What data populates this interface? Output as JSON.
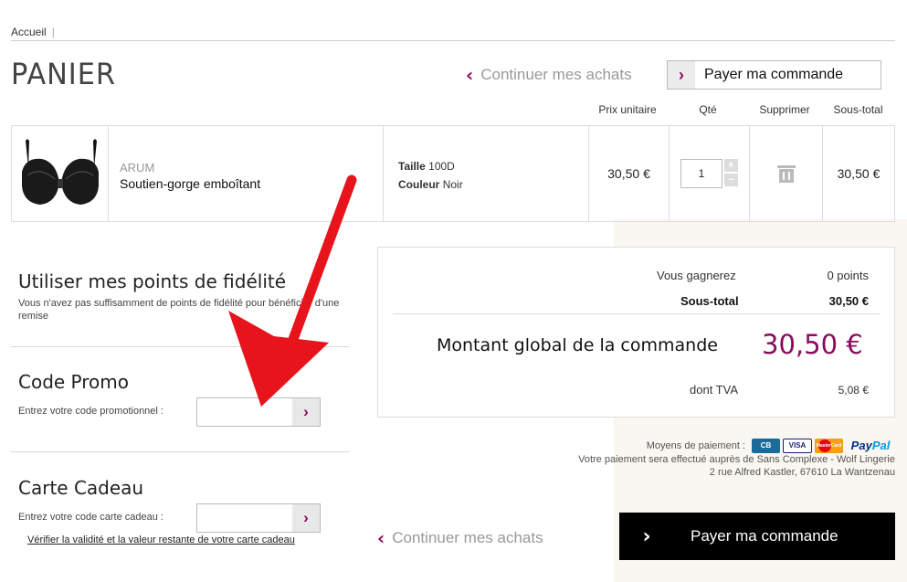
{
  "breadcrumb": {
    "home": "Accueil",
    "separator": "|"
  },
  "page_title": "PANIER",
  "header_actions": {
    "continue_label": "Continuer mes achats",
    "pay_label": "Payer ma commande"
  },
  "columns": {
    "unit_price": "Prix unitaire",
    "qty": "Qté",
    "delete": "Supprimer",
    "subtotal": "Sous-total"
  },
  "cart_item": {
    "brand": "ARUM",
    "name": "Soutien-gorge emboîtant",
    "size_label": "Taille",
    "size_value": "100D",
    "color_label": "Couleur",
    "color_value": "Noir",
    "unit_price": "30,50 €",
    "quantity": "1",
    "qty_plus": "+",
    "qty_minus": "−",
    "subtotal": "30,50 €"
  },
  "loyalty": {
    "title": "Utiliser mes points de fidélité",
    "desc": "Vous n'avez pas suffisamment de points de fidélité pour bénéficier d'une remise"
  },
  "promo": {
    "title": "Code Promo",
    "label": "Entrez votre code promotionnel :",
    "value": ""
  },
  "gift": {
    "title": "Carte Cadeau",
    "label": "Entrez votre code carte cadeau :",
    "value": "",
    "check_link": "Vérifier la validité et la valeur restante de votre carte cadeau"
  },
  "summary": {
    "earn_label": "Vous gagnerez",
    "earn_value": "0 points",
    "subtotal_label": "Sous-total",
    "subtotal_value": "30,50 €",
    "total_label": "Montant global de la commande",
    "total_value": "30,50 €",
    "vat_label": "dont TVA",
    "vat_value": "5,08 €"
  },
  "payment": {
    "methods_label": "Moyens de paiement :",
    "cards": [
      "CB",
      "VISA",
      "MasterCard",
      "PayPal"
    ],
    "line2": "Votre paiement sera effectué auprès de Sans Complexe - Wolf Lingerie",
    "line3": "2 rue Alfred Kastler, 67610 La Wantzenau"
  },
  "footer_actions": {
    "continue_label": "Continuer mes achats",
    "pay_label": "Payer ma commande"
  },
  "colors": {
    "accent": "#8a0c5c",
    "annotation_arrow": "#e8141c"
  }
}
